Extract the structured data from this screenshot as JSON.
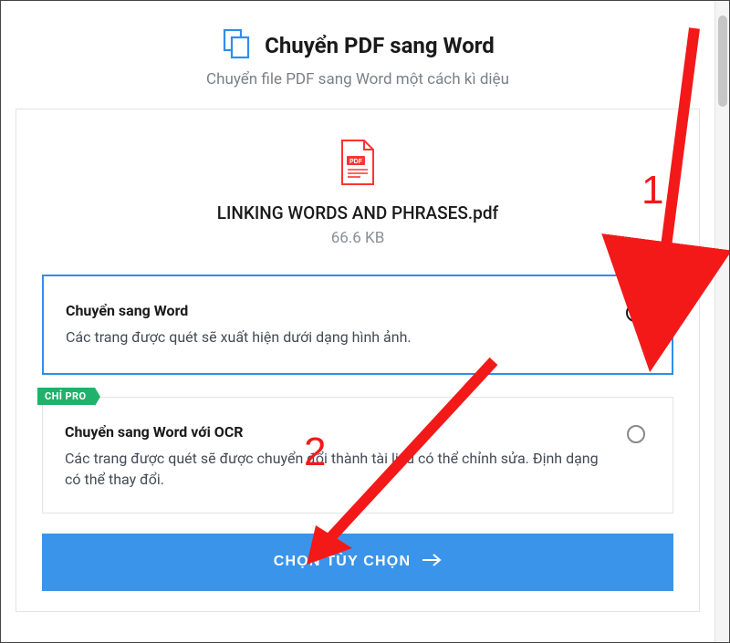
{
  "header": {
    "title": "Chuyển PDF sang Word",
    "subtitle": "Chuyển file PDF sang Word một cách kì diệu"
  },
  "file": {
    "name": "LINKING WORDS AND PHRASES.pdf",
    "size": "66.6 KB",
    "badge": "PDF"
  },
  "options": [
    {
      "title": "Chuyển sang Word",
      "desc": "Các trang được quét sẽ xuất hiện dưới dạng hình ảnh.",
      "selected": true
    },
    {
      "title": "Chuyển sang Word với OCR",
      "desc": "Các trang được quét sẽ được chuyển đổi thành tài liệu có thể chỉnh sửa. Định dạng có thể thay đổi.",
      "selected": false,
      "pro_label": "CHỈ PRO"
    }
  ],
  "cta_label": "CHỌN TÙY CHỌN",
  "annotations": {
    "num1": "1",
    "num2": "2"
  }
}
